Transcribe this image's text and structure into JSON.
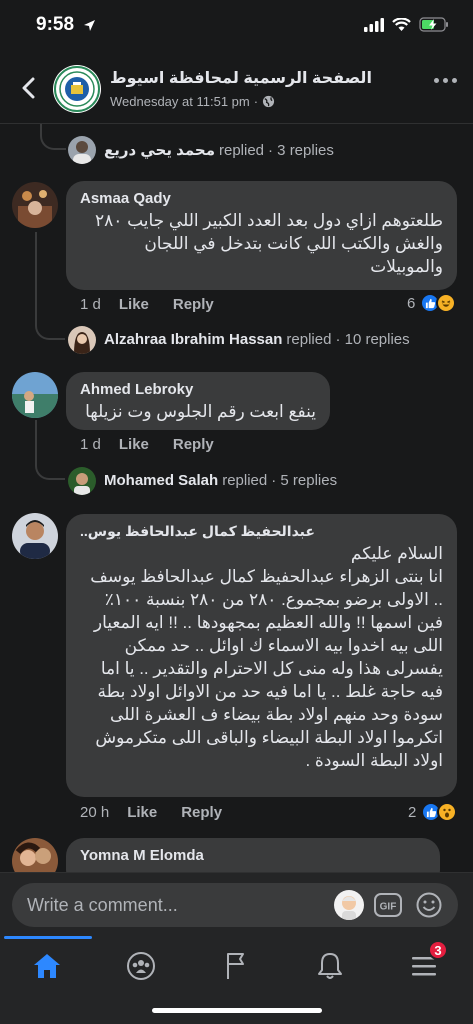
{
  "status": {
    "time": "9:58"
  },
  "header": {
    "page_name": "الصفحة الرسمية لمحافظة اسيوط",
    "posted": "Wednesday at 11:51 pm"
  },
  "thread": {
    "top_reply": {
      "name": "محمد يحي دريع",
      "verb": "replied",
      "count": "· 3 replies"
    },
    "comments": [
      {
        "author": "Asmaa Qady",
        "text": "طلعتوهم ازاي دول بعد العدد الكبير اللي جايب ٢٨٠ والغش والكتب اللي كانت بتدخل في اللجان والموبيلات",
        "time": "1 d",
        "like": "Like",
        "reply": "Reply",
        "reactions": "6",
        "replies": {
          "name": "Alzahraa Ibrahim Hassan",
          "verb": "replied",
          "count": "· 10 replies"
        }
      },
      {
        "author": "Ahmed Lebroky",
        "text": "ينفع ابعت رقم الجلوس وت نزيلها",
        "time": "1 d",
        "like": "Like",
        "reply": "Reply",
        "replies": {
          "name": "Mohamed Salah",
          "verb": "replied",
          "count": "· 5 replies"
        }
      },
      {
        "author": "عبدالحفيظ كمال عبدالحافظ يوس..",
        "text": "السلام عليكم\nانا بنتى الزهراء عبدالحفيظ كمال عبدالحافظ يوسف .. الاولى برضو بمجموع. ٢٨٠ من ٢٨٠ بنسبة ١٠٠٪ فين اسمها !! والله العظيم بمجهودها .. !! ايه المعيار اللى بيه اخدوا بيه الاسماء ك اوائل .. حد ممكن يفسرلى هذا وله منى كل الاحترام والتقدير .. يا اما فيه حاجة غلط .. يا اما فيه حد من الاوائل اولاد بطة سودة وحد منهم اولاد بطة بيضاء ف العشرة اللى اتكرموا اولاد البطة البيضاء والباقى اللى متكرموش اولاد البطة السودة .",
        "time": "20 h",
        "like": "Like",
        "reply": "Reply",
        "reactions": "2"
      },
      {
        "author": "Yomna M Elomda"
      }
    ]
  },
  "composer": {
    "placeholder": "Write a comment..."
  },
  "tabbar": {
    "menu_badge": "3"
  },
  "colors": {
    "accent": "#2d88ff",
    "bubble": "#3a3b3c",
    "background": "#18191a"
  }
}
